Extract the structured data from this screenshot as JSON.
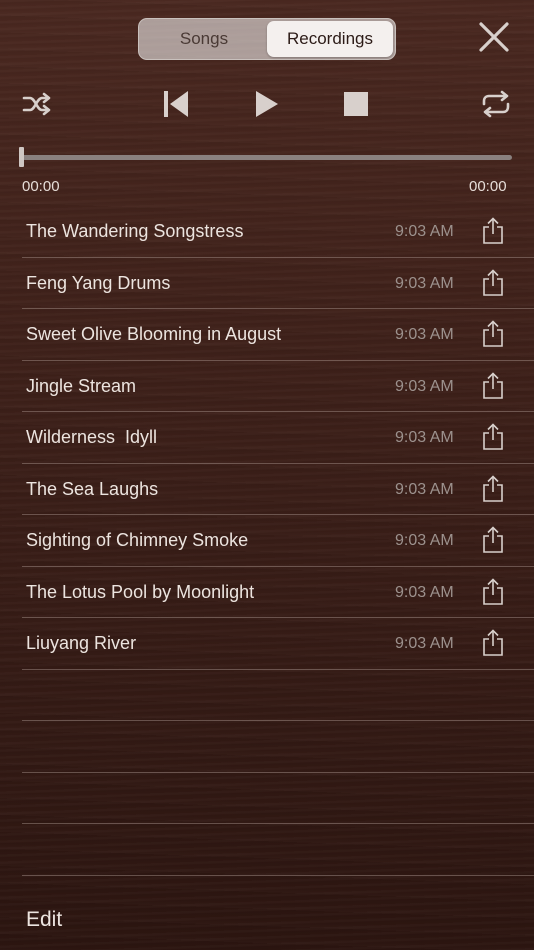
{
  "tabs": [
    {
      "label": "Songs",
      "active": false
    },
    {
      "label": "Recordings",
      "active": true
    }
  ],
  "controls": {
    "shuffle_icon": "shuffle-icon",
    "previous_icon": "skip-back-icon",
    "play_icon": "play-icon",
    "stop_icon": "stop-icon",
    "repeat_icon": "repeat-icon",
    "close_icon": "close-icon"
  },
  "progress": {
    "fraction": 0.0,
    "elapsed": "00:00",
    "duration": "00:00"
  },
  "recordings": [
    {
      "title": "The Wandering Songstress",
      "time": "9:03 AM"
    },
    {
      "title": "Feng Yang Drums",
      "time": "9:03 AM"
    },
    {
      "title": "Sweet Olive Blooming in August",
      "time": "9:03 AM"
    },
    {
      "title": "Jingle Stream",
      "time": "9:03 AM"
    },
    {
      "title": "Wilderness  Idyll",
      "time": "9:03 AM"
    },
    {
      "title": "The Sea Laughs",
      "time": "9:03 AM"
    },
    {
      "title": "Sighting of Chimney Smoke",
      "time": "9:03 AM"
    },
    {
      "title": "The Lotus Pool by Moonlight",
      "time": "9:03 AM"
    },
    {
      "title": "Liuyang River",
      "time": "9:03 AM"
    }
  ],
  "footer": {
    "edit_label": "Edit"
  },
  "colors": {
    "background": "#3f211a",
    "text": "#ece4df",
    "muted_text": "#9c918d",
    "segment_active": "#f4f0ee"
  }
}
